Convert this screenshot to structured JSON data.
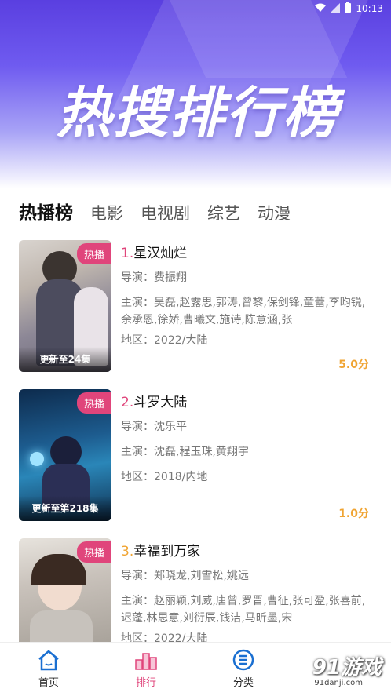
{
  "status": {
    "time": "10:13"
  },
  "hero": {
    "title": "热搜排行榜"
  },
  "tabs": [
    {
      "label": "热播榜",
      "active": true
    },
    {
      "label": "电影"
    },
    {
      "label": "电视剧"
    },
    {
      "label": "综艺"
    },
    {
      "label": "动漫"
    }
  ],
  "items": [
    {
      "rank": "1.",
      "title": "星汉灿烂",
      "badge": "热播",
      "update": "更新至24集",
      "director": "导演：费振翔",
      "cast": "主演：吴磊,赵露思,郭涛,曾黎,保剑锋,童蕾,李昀锐,余承恩,徐娇,曹曦文,施诗,陈意涵,张",
      "region": "地区：2022/大陆",
      "score": "5.0分"
    },
    {
      "rank": "2.",
      "title": "斗罗大陆",
      "badge": "热播",
      "update": "更新至第218集",
      "director": "导演：沈乐平",
      "cast": "主演：沈磊,程玉珠,黄翔宇",
      "region": "地区：2018/内地",
      "score": "1.0分"
    },
    {
      "rank": "3.",
      "title": "幸福到万家",
      "badge": "热播",
      "update": "",
      "director": "导演：郑晓龙,刘雪松,姚远",
      "cast": "主演：赵丽颖,刘威,唐曾,罗晋,曹征,张可盈,张喜前,迟蓬,林思意,刘衍辰,钱洁,马昕墨,宋",
      "region": "地区：2022/大陆",
      "score": ""
    }
  ],
  "nav": [
    {
      "label": "首页",
      "icon": "home-icon"
    },
    {
      "label": "排行",
      "icon": "ranking-icon",
      "active": true
    },
    {
      "label": "分类",
      "icon": "category-icon"
    }
  ],
  "watermark": {
    "text": "91游戏",
    "url": "91danji.com"
  },
  "colors": {
    "accent": "#e0457b",
    "score": "#f0a432",
    "nav_blue": "#1a6fd1"
  }
}
